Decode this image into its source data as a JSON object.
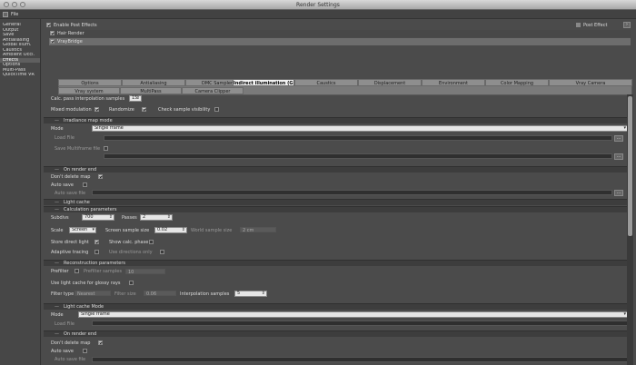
{
  "window": {
    "title": "Render Settings"
  },
  "menubar": {
    "file_label": "File"
  },
  "sidebar": {
    "items": [
      {
        "label": "General"
      },
      {
        "label": "Output"
      },
      {
        "label": "Save"
      },
      {
        "label": "Antialiasing"
      },
      {
        "label": "Global Illum."
      },
      {
        "label": "Caustics"
      },
      {
        "label": "Ambient Occl."
      },
      {
        "label": "Effects"
      },
      {
        "label": "Options"
      },
      {
        "label": "Multi-Pass"
      },
      {
        "label": "QuickTime VR"
      }
    ]
  },
  "effects": {
    "enable_label": "Enable Post Effects",
    "post_effect_label": "Post Effect",
    "list": [
      {
        "label": "Hair Render"
      },
      {
        "label": "VrayBridge"
      }
    ]
  },
  "tabs": {
    "row1": [
      "Options",
      "Antialiasing",
      "DMC Sampler",
      "Indirect illumination (GI)",
      "Caustics",
      "Displacement",
      "Environment",
      "Color Mapping",
      "Vray Camera"
    ],
    "row2": [
      "Vray system",
      "MultiPass",
      "Camera Clipper"
    ]
  },
  "gi": {
    "subdivs_label": "Calc. pass interpolation samples",
    "subdivs_value": "15",
    "multipass_label": "Mixed modulation",
    "randomize_label": "Randomize",
    "check_vis_label": "Check sample visibility"
  },
  "irradiance": {
    "section_label": "Irradiance map mode",
    "mode_label": "Mode",
    "mode_value": "Single frame",
    "load_label": "Load File",
    "save_label": "Save Multiframe file"
  },
  "onrender1": {
    "section_label": "On render end",
    "dont_delete_label": "Don't delete map",
    "autosave_label": "Auto save",
    "autosave_file_label": "Auto save file"
  },
  "lightcache": {
    "section_label": "Light cache"
  },
  "calc": {
    "section_label": "Calculation parameters",
    "subdivs_label": "Subdivs",
    "subdivs_value": "700",
    "passes_label": "Passes",
    "passes_value": "2",
    "scale_label": "Scale",
    "scale_value": "Screen",
    "sample_size_label": "Screen sample size",
    "sample_size_value": "0.02",
    "world_size_label": "World sample size",
    "world_size_value": "2 cm",
    "store_direct_label": "Store direct light",
    "show_calc_label": "Show calc. phase",
    "adaptive_label": "Adaptive tracing",
    "directions_label": "Use directions only"
  },
  "recon": {
    "section_label": "Reconstruction parameters",
    "prefilter_label": "Prefilter",
    "prefilter_samples_label": "Prefilter samples",
    "prefilter_samples_value": "10",
    "glossy_label": "Use light cache for glossy rays",
    "filter_label": "Filter type",
    "filter_value": "Nearest",
    "filter_size_label": "Filter size",
    "filter_size_value": "0.06",
    "interp_label": "Interpolation samples",
    "interp_value": "5"
  },
  "lcmode": {
    "section_label": "Light cache Mode",
    "mode_label": "Mode",
    "mode_value": "Single frame",
    "load_label": "Load File"
  },
  "onrender2": {
    "section_label": "On render end",
    "dont_delete_label": "Don't delete map",
    "autosave_label": "Auto save",
    "autosave_file_label": "Auto save file"
  },
  "ellipsis": "..."
}
